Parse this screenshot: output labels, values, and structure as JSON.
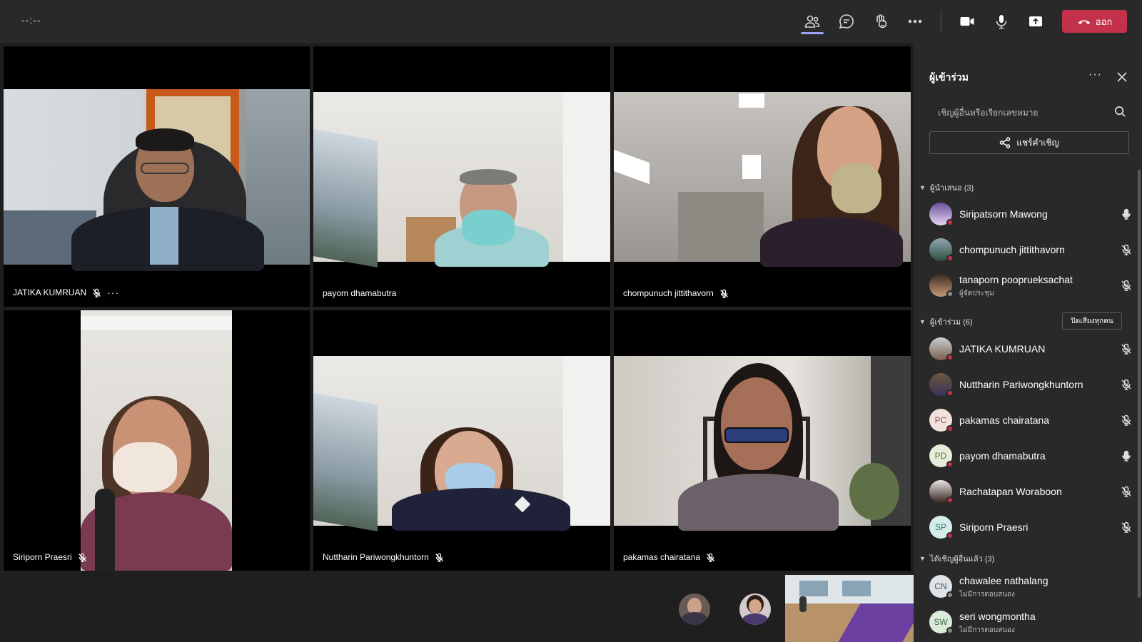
{
  "topbar": {
    "timer": "--:--",
    "icons": [
      "people-icon",
      "chat-icon",
      "reactions-icon",
      "more-icon",
      "camera-icon",
      "mic-icon",
      "share-tray-icon",
      "phone-hangup-icon"
    ],
    "leave_label": "ออก",
    "colors": {
      "leave": "#c4314b",
      "active_indicator": "#9ea2ff"
    }
  },
  "tiles": [
    {
      "name": "JATIKA KUMRUAN",
      "muted": true,
      "more": "···"
    },
    {
      "name": "payom dhamabutra",
      "muted": false
    },
    {
      "name": "chompunuch jittithavorn",
      "muted": true
    },
    {
      "name": "Siriporn Praesri",
      "muted": true
    },
    {
      "name": "Nuttharin Pariwongkhuntorn",
      "muted": true
    },
    {
      "name": "pakamas chairatana",
      "muted": true
    }
  ],
  "panel": {
    "title": "ผู้เข้าร่วม",
    "more": "···",
    "search_placeholder": "เชิญผู้อื่นหรือเรียกเลขหมาย",
    "share_label": "แชร์คำเชิญ",
    "sections": {
      "presenters": "ผู้นำเสนอ (3)",
      "attendees": "ผู้เข้าร่วม (6)",
      "invited": "ได้เชิญผู้อื่นแล้ว (3)"
    },
    "mute_all_label": "ปิดเสียงทุกคน",
    "presenters": [
      {
        "name": "Siripatsorn Mawong",
        "sub": "",
        "mic": "on"
      },
      {
        "name": "chompunuch jittithavorn",
        "sub": "",
        "mic": "off"
      },
      {
        "name": "tanaporn pooprueksachat",
        "sub": "ผู้จัดประชุม",
        "mic": "off"
      }
    ],
    "attendees": [
      {
        "name": "JATIKA KUMRUAN",
        "initials": "",
        "mic": "off"
      },
      {
        "name": "Nuttharin Pariwongkhuntorn",
        "initials": "",
        "mic": "off"
      },
      {
        "name": "pakamas chairatana",
        "initials": "PC",
        "mic": "off"
      },
      {
        "name": "payom dhamabutra",
        "initials": "PD",
        "mic": "on"
      },
      {
        "name": "Rachatapan Woraboon",
        "initials": "",
        "mic": "off"
      },
      {
        "name": "Siriporn Praesri",
        "initials": "SP",
        "mic": "off"
      }
    ],
    "invited": [
      {
        "name": "chawalee nathalang",
        "initials": "CN",
        "sub": "ไม่มีการตอบสนอง"
      },
      {
        "name": "seri wongmontha",
        "initials": "SW",
        "sub": "ไม่มีการตอบสนอง"
      }
    ],
    "colors": {
      "busy_dot": "#c4314b",
      "avatar_bg": "#f3e1de",
      "avatar_fg": "#8a5a55"
    }
  }
}
